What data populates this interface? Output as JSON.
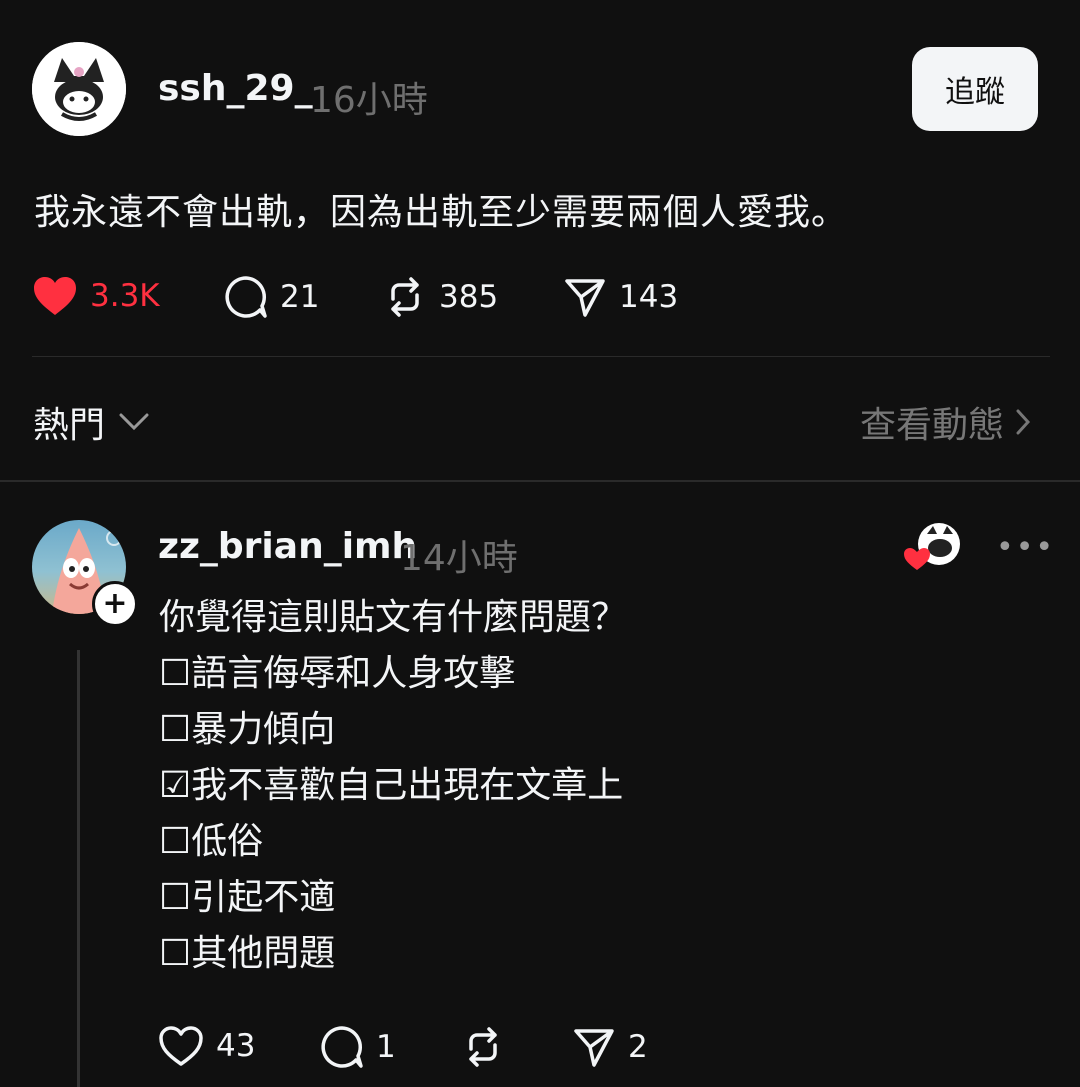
{
  "post": {
    "username": "ssh_29_",
    "time": "16小時",
    "follow_label": "追蹤",
    "text": "我永遠不會出軌，因為出軌至少需要兩個人愛我。",
    "like_count": "3.3K",
    "reply_count": "21",
    "repost_count": "385",
    "share_count": "143",
    "liked": true
  },
  "sort_bar": {
    "sort_label": "熱門",
    "view_activity_label": "查看動態"
  },
  "reply": {
    "username": "zz_brian_imh",
    "time": "14小時",
    "lines": [
      "你覺得這則貼文有什麼問題？",
      "☐語言侮辱和人身攻擊",
      "☐暴力傾向",
      "☑我不喜歡自己出現在文章上",
      "☐低俗",
      "☐引起不適",
      "☐其他問題"
    ],
    "like_count": "43",
    "reply_count": "1",
    "share_count": "2",
    "plus_label": "+",
    "more_label": "•••"
  },
  "colors": {
    "background": "#101010",
    "like_red": "#ff3040",
    "muted": "#777777"
  }
}
